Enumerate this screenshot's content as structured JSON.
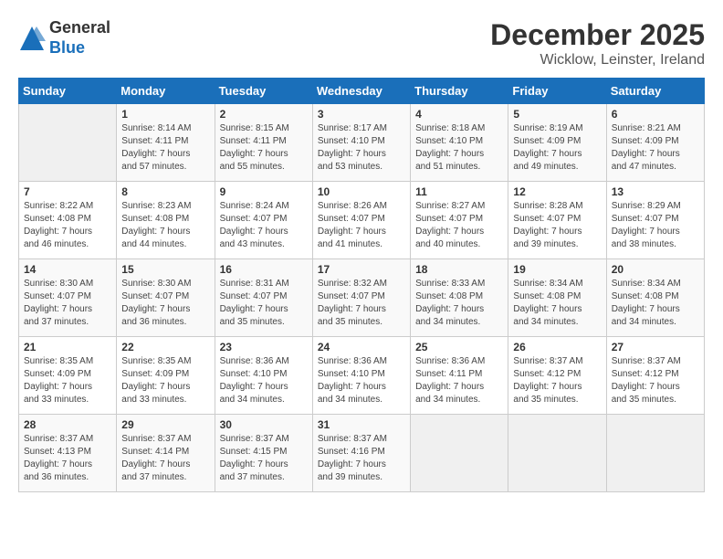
{
  "header": {
    "logo_line1": "General",
    "logo_line2": "Blue",
    "month": "December 2025",
    "location": "Wicklow, Leinster, Ireland"
  },
  "days_of_week": [
    "Sunday",
    "Monday",
    "Tuesday",
    "Wednesday",
    "Thursday",
    "Friday",
    "Saturday"
  ],
  "weeks": [
    [
      {
        "day": "",
        "info": ""
      },
      {
        "day": "1",
        "info": "Sunrise: 8:14 AM\nSunset: 4:11 PM\nDaylight: 7 hours\nand 57 minutes."
      },
      {
        "day": "2",
        "info": "Sunrise: 8:15 AM\nSunset: 4:11 PM\nDaylight: 7 hours\nand 55 minutes."
      },
      {
        "day": "3",
        "info": "Sunrise: 8:17 AM\nSunset: 4:10 PM\nDaylight: 7 hours\nand 53 minutes."
      },
      {
        "day": "4",
        "info": "Sunrise: 8:18 AM\nSunset: 4:10 PM\nDaylight: 7 hours\nand 51 minutes."
      },
      {
        "day": "5",
        "info": "Sunrise: 8:19 AM\nSunset: 4:09 PM\nDaylight: 7 hours\nand 49 minutes."
      },
      {
        "day": "6",
        "info": "Sunrise: 8:21 AM\nSunset: 4:09 PM\nDaylight: 7 hours\nand 47 minutes."
      }
    ],
    [
      {
        "day": "7",
        "info": "Sunrise: 8:22 AM\nSunset: 4:08 PM\nDaylight: 7 hours\nand 46 minutes."
      },
      {
        "day": "8",
        "info": "Sunrise: 8:23 AM\nSunset: 4:08 PM\nDaylight: 7 hours\nand 44 minutes."
      },
      {
        "day": "9",
        "info": "Sunrise: 8:24 AM\nSunset: 4:07 PM\nDaylight: 7 hours\nand 43 minutes."
      },
      {
        "day": "10",
        "info": "Sunrise: 8:26 AM\nSunset: 4:07 PM\nDaylight: 7 hours\nand 41 minutes."
      },
      {
        "day": "11",
        "info": "Sunrise: 8:27 AM\nSunset: 4:07 PM\nDaylight: 7 hours\nand 40 minutes."
      },
      {
        "day": "12",
        "info": "Sunrise: 8:28 AM\nSunset: 4:07 PM\nDaylight: 7 hours\nand 39 minutes."
      },
      {
        "day": "13",
        "info": "Sunrise: 8:29 AM\nSunset: 4:07 PM\nDaylight: 7 hours\nand 38 minutes."
      }
    ],
    [
      {
        "day": "14",
        "info": "Sunrise: 8:30 AM\nSunset: 4:07 PM\nDaylight: 7 hours\nand 37 minutes."
      },
      {
        "day": "15",
        "info": "Sunrise: 8:30 AM\nSunset: 4:07 PM\nDaylight: 7 hours\nand 36 minutes."
      },
      {
        "day": "16",
        "info": "Sunrise: 8:31 AM\nSunset: 4:07 PM\nDaylight: 7 hours\nand 35 minutes."
      },
      {
        "day": "17",
        "info": "Sunrise: 8:32 AM\nSunset: 4:07 PM\nDaylight: 7 hours\nand 35 minutes."
      },
      {
        "day": "18",
        "info": "Sunrise: 8:33 AM\nSunset: 4:08 PM\nDaylight: 7 hours\nand 34 minutes."
      },
      {
        "day": "19",
        "info": "Sunrise: 8:34 AM\nSunset: 4:08 PM\nDaylight: 7 hours\nand 34 minutes."
      },
      {
        "day": "20",
        "info": "Sunrise: 8:34 AM\nSunset: 4:08 PM\nDaylight: 7 hours\nand 34 minutes."
      }
    ],
    [
      {
        "day": "21",
        "info": "Sunrise: 8:35 AM\nSunset: 4:09 PM\nDaylight: 7 hours\nand 33 minutes."
      },
      {
        "day": "22",
        "info": "Sunrise: 8:35 AM\nSunset: 4:09 PM\nDaylight: 7 hours\nand 33 minutes."
      },
      {
        "day": "23",
        "info": "Sunrise: 8:36 AM\nSunset: 4:10 PM\nDaylight: 7 hours\nand 34 minutes."
      },
      {
        "day": "24",
        "info": "Sunrise: 8:36 AM\nSunset: 4:10 PM\nDaylight: 7 hours\nand 34 minutes."
      },
      {
        "day": "25",
        "info": "Sunrise: 8:36 AM\nSunset: 4:11 PM\nDaylight: 7 hours\nand 34 minutes."
      },
      {
        "day": "26",
        "info": "Sunrise: 8:37 AM\nSunset: 4:12 PM\nDaylight: 7 hours\nand 35 minutes."
      },
      {
        "day": "27",
        "info": "Sunrise: 8:37 AM\nSunset: 4:12 PM\nDaylight: 7 hours\nand 35 minutes."
      }
    ],
    [
      {
        "day": "28",
        "info": "Sunrise: 8:37 AM\nSunset: 4:13 PM\nDaylight: 7 hours\nand 36 minutes."
      },
      {
        "day": "29",
        "info": "Sunrise: 8:37 AM\nSunset: 4:14 PM\nDaylight: 7 hours\nand 37 minutes."
      },
      {
        "day": "30",
        "info": "Sunrise: 8:37 AM\nSunset: 4:15 PM\nDaylight: 7 hours\nand 37 minutes."
      },
      {
        "day": "31",
        "info": "Sunrise: 8:37 AM\nSunset: 4:16 PM\nDaylight: 7 hours\nand 39 minutes."
      },
      {
        "day": "",
        "info": ""
      },
      {
        "day": "",
        "info": ""
      },
      {
        "day": "",
        "info": ""
      }
    ]
  ]
}
